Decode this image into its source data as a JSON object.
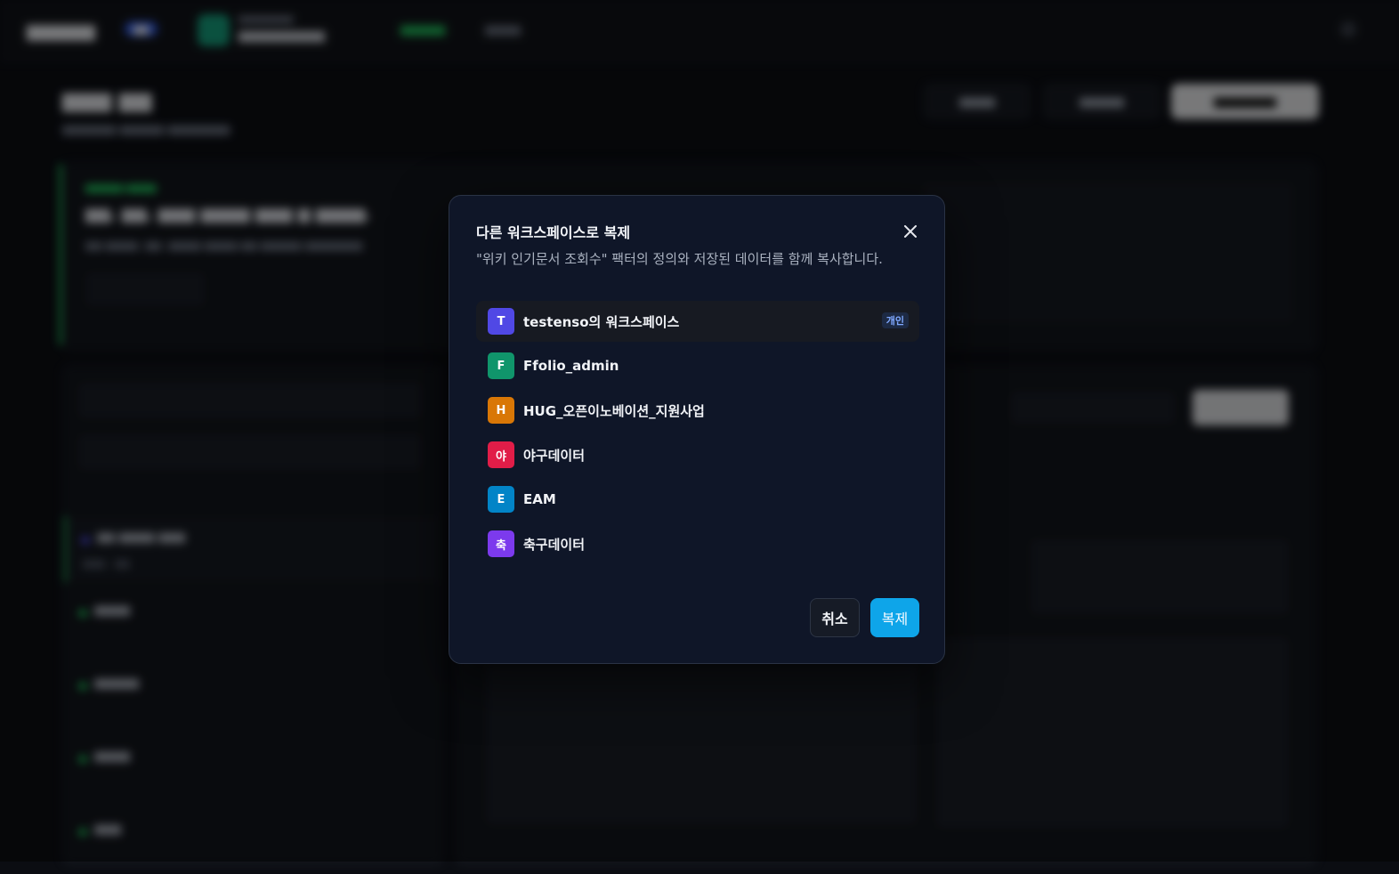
{
  "modal": {
    "title": "다른 워크스페이스로 복제",
    "description": "\"위키 인기문서 조회수\" 팩터의 정의와 저장된 데이터를 함께 복사합니다.",
    "close_icon": "close-icon",
    "personal_tag": "개인",
    "workspaces": [
      {
        "initial": "T",
        "name": "testenso의 워크스페이스",
        "color": "#5048e5",
        "selected": true,
        "personal": true
      },
      {
        "initial": "F",
        "name": "Ffolio_admin",
        "color": "#10956b"
      },
      {
        "initial": "H",
        "name": "HUG_오픈이노베이션_지원사업",
        "color": "#d97706"
      },
      {
        "initial": "야",
        "name": "야구데이터",
        "color": "#e11d48"
      },
      {
        "initial": "E",
        "name": "EAM",
        "color": "#0284c7"
      },
      {
        "initial": "축",
        "name": "축구데이터",
        "color": "#7c3aed"
      }
    ],
    "cancel_label": "취소",
    "copy_label": "복제"
  },
  "colors": {
    "accent": "#0ea5e9",
    "modal_bg": "#0f1628",
    "page_bg": "#0b0d12",
    "success": "#22c55e"
  }
}
